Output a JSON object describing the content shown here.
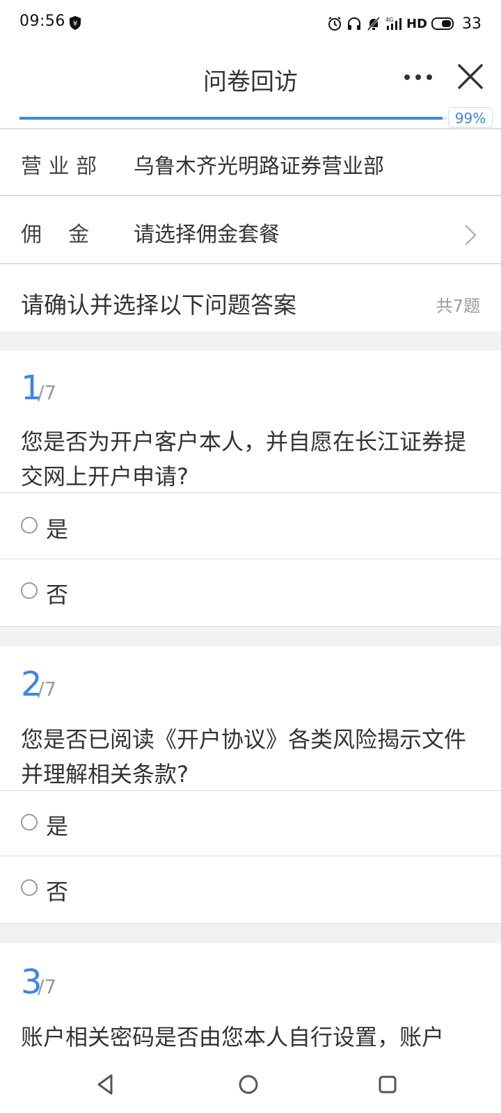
{
  "status": {
    "time": "09:56",
    "network": "HD",
    "battery": "33"
  },
  "header": {
    "title": "问卷回访"
  },
  "progress": {
    "percent": 99,
    "label": "99%"
  },
  "branch": {
    "label": "营 业 部",
    "value": "乌鲁木齐光明路证券营业部"
  },
  "commission": {
    "label": "佣    金",
    "placeholder": "请选择佣金套餐"
  },
  "intro": {
    "text": "请确认并选择以下问题答案",
    "count": "共7题"
  },
  "questions": [
    {
      "number": "1",
      "total": "/7",
      "text": "您是否为开户客户本人，并自愿在长江证券提交网上开户申请?",
      "options": [
        "是",
        "否"
      ]
    },
    {
      "number": "2",
      "total": "/7",
      "text": "您是否已阅读《开户协议》各类风险揭示文件并理解相关条款?",
      "options": [
        "是",
        "否"
      ]
    },
    {
      "number": "3",
      "total": "/7",
      "text": "账户相关密码是否由您本人自行设置，账户"
    }
  ]
}
